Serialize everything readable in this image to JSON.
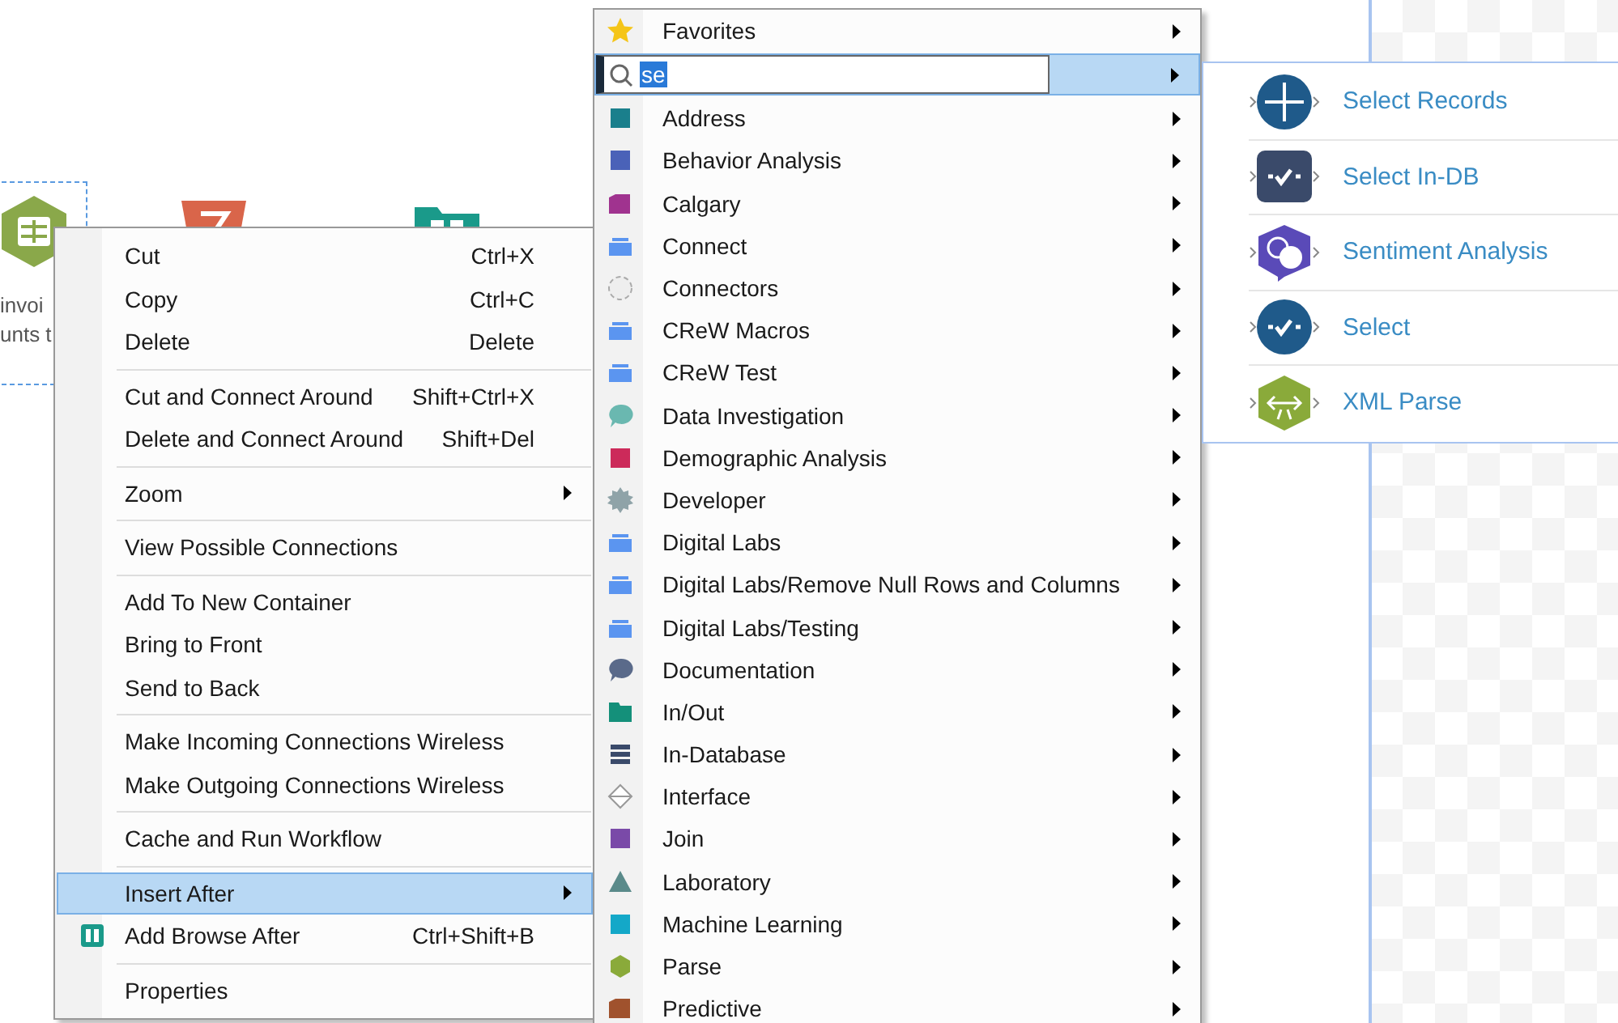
{
  "canvas": {
    "nodes": [
      {
        "kind": "table",
        "color": "#8aa84a",
        "label_lines": [
          "invoi",
          "unts t"
        ],
        "selected": true
      },
      {
        "kind": "formula",
        "color": "#d9654a",
        "selected": false
      },
      {
        "kind": "browse",
        "color": "#1a9a8a",
        "selected": false
      }
    ]
  },
  "context_menu": {
    "sections": [
      [
        {
          "label": "Cut",
          "shortcut": "Ctrl+X",
          "submenu": false,
          "selected": false
        },
        {
          "label": "Copy",
          "shortcut": "Ctrl+C",
          "submenu": false,
          "selected": false
        },
        {
          "label": "Delete",
          "shortcut": "Delete",
          "submenu": false,
          "selected": false
        }
      ],
      [
        {
          "label": "Cut and Connect Around",
          "shortcut": "Shift+Ctrl+X",
          "submenu": false,
          "selected": false
        },
        {
          "label": "Delete and Connect Around",
          "shortcut": "Shift+Del",
          "submenu": false,
          "selected": false
        }
      ],
      [
        {
          "label": "Zoom",
          "submenu": true,
          "selected": false
        }
      ],
      [
        {
          "label": "View Possible Connections",
          "submenu": false,
          "selected": false
        }
      ],
      [
        {
          "label": "Add To New Container",
          "submenu": false,
          "selected": false
        },
        {
          "label": "Bring to Front",
          "submenu": false,
          "selected": false
        },
        {
          "label": "Send to Back",
          "submenu": false,
          "selected": false
        }
      ],
      [
        {
          "label": "Make Incoming Connections Wireless",
          "submenu": false,
          "selected": false
        },
        {
          "label": "Make Outgoing Connections Wireless",
          "submenu": false,
          "selected": false
        }
      ],
      [
        {
          "label": "Cache and Run Workflow",
          "submenu": false,
          "selected": false
        }
      ],
      [
        {
          "label": "Insert After",
          "submenu": true,
          "selected": true
        },
        {
          "label": "Add Browse After",
          "shortcut": "Ctrl+Shift+B",
          "submenu": false,
          "selected": false,
          "kind": "browse"
        }
      ],
      [
        {
          "label": "Properties",
          "submenu": false,
          "selected": false
        }
      ]
    ]
  },
  "category_menu": {
    "favorites": {
      "label": "Favorites",
      "selected": false
    },
    "search": {
      "value": "se",
      "selected": true
    },
    "categories": [
      {
        "label": "Address",
        "kind": "stamp",
        "color": "#1a7f8c",
        "selected": false
      },
      {
        "label": "Behavior Analysis",
        "kind": "stamp",
        "color": "#4a62b8",
        "selected": false
      },
      {
        "label": "Calgary",
        "kind": "tab",
        "color": "#a0338f",
        "selected": false
      },
      {
        "label": "Connect",
        "kind": "stack",
        "color": "#5b95f0",
        "selected": false
      },
      {
        "label": "Connectors",
        "kind": "dashed",
        "color": "#aaaaaa",
        "selected": false
      },
      {
        "label": "CReW Macros",
        "kind": "stack",
        "color": "#5b95f0",
        "selected": false
      },
      {
        "label": "CReW Test",
        "kind": "stack",
        "color": "#5b95f0",
        "selected": false
      },
      {
        "label": "Data Investigation",
        "kind": "bubble",
        "color": "#6ab8b0",
        "selected": false
      },
      {
        "label": "Demographic Analysis",
        "kind": "stamp",
        "color": "#cc2a5a",
        "selected": false
      },
      {
        "label": "Developer",
        "kind": "gear",
        "color": "#8fa3a8",
        "selected": false
      },
      {
        "label": "Digital Labs",
        "kind": "stack",
        "color": "#5b95f0",
        "selected": false
      },
      {
        "label": "Digital Labs/Remove Null Rows and Columns",
        "kind": "stack",
        "color": "#5b95f0",
        "selected": false
      },
      {
        "label": "Digital Labs/Testing",
        "kind": "stack",
        "color": "#5b95f0",
        "selected": false
      },
      {
        "label": "Documentation",
        "kind": "bubble",
        "color": "#5a6a8a",
        "selected": false
      },
      {
        "label": "In/Out",
        "kind": "folder",
        "color": "#14907a",
        "selected": false
      },
      {
        "label": "In-Database",
        "kind": "database",
        "color": "#3a4a6a",
        "selected": false
      },
      {
        "label": "Interface",
        "kind": "diamond",
        "color": "#999999",
        "selected": false
      },
      {
        "label": "Join",
        "kind": "square",
        "color": "#7a4aa8",
        "selected": false
      },
      {
        "label": "Laboratory",
        "kind": "triangle",
        "color": "#5a8a8a",
        "selected": false
      },
      {
        "label": "Machine Learning",
        "kind": "stamp",
        "color": "#14a8c8",
        "selected": false
      },
      {
        "label": "Parse",
        "kind": "hexagon",
        "color": "#8aaa3a",
        "selected": false
      },
      {
        "label": "Predictive",
        "kind": "tab",
        "color": "#a0522d",
        "selected": false
      }
    ]
  },
  "search_results": [
    {
      "label": "Select Records",
      "kind": "cross",
      "color": "#1f5a8a"
    },
    {
      "label": "Select In-DB",
      "kind": "check-square",
      "color": "#3a4a6a"
    },
    {
      "label": "Sentiment Analysis",
      "kind": "faces",
      "color": "#5a4ab8"
    },
    {
      "label": "Select",
      "kind": "check",
      "color": "#1f5a8a"
    },
    {
      "label": "XML Parse",
      "kind": "parse",
      "color": "#8aaa3a"
    }
  ]
}
